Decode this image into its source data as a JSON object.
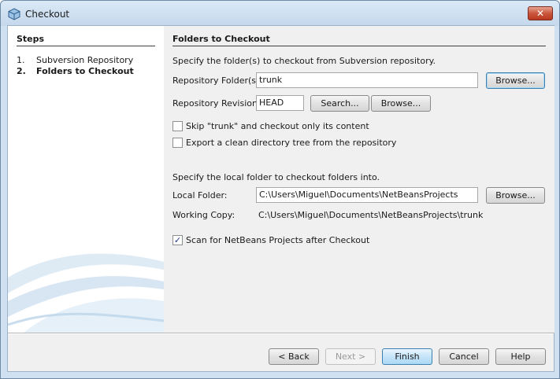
{
  "window": {
    "title": "Checkout",
    "close_label": "✕"
  },
  "steps": {
    "heading": "Steps",
    "items": [
      {
        "num": "1.",
        "label": "Subversion Repository"
      },
      {
        "num": "2.",
        "label": "Folders to Checkout"
      }
    ]
  },
  "panel": {
    "title": "Folders to Checkout",
    "intro": "Specify the folder(s) to checkout from Subversion repository.",
    "repo_folder_label": "Repository Folder(s):",
    "repo_folder_value": "trunk",
    "browse_label": "Browse...",
    "repo_revision_label": "Repository Revision:",
    "repo_revision_value": "HEAD",
    "search_label": "Search...",
    "skip_trunk_label": "Skip \"trunk\" and checkout only its content",
    "skip_trunk_checked": false,
    "export_label": "Export a clean directory tree from the repository",
    "export_checked": false,
    "local_intro": "Specify the local folder to checkout folders into.",
    "local_folder_label": "Local Folder:",
    "local_folder_value": "C:\\Users\\Miguel\\Documents\\NetBeansProjects",
    "working_copy_label": "Working Copy:",
    "working_copy_value": "C:\\Users\\Miguel\\Documents\\NetBeansProjects\\trunk",
    "scan_label": "Scan for NetBeans Projects after Checkout",
    "scan_checked": true,
    "check_mark": "✓"
  },
  "footer": {
    "back_label": "< Back",
    "next_label": "Next >",
    "finish_label": "Finish",
    "cancel_label": "Cancel",
    "help_label": "Help"
  },
  "colors": {
    "title_bar": "#c4d8ec",
    "close_button": "#c9563c",
    "panel_background": "#f0f0f0",
    "focus_border": "#3c7fb1"
  }
}
